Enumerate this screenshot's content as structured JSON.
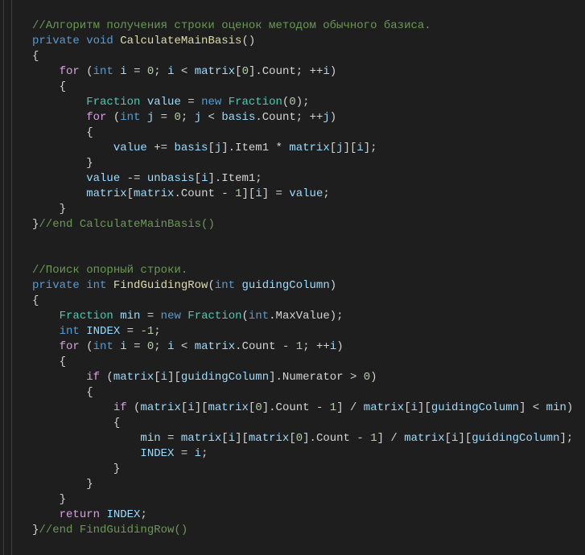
{
  "comments": {
    "algo": "//Алгоритм получения строки оценок методом обычного базиса.",
    "endBasis": "//end CalculateMainBasis()",
    "search": "//Поиск опорный строки.",
    "endGuiding": "//end FindGuidingRow()"
  },
  "kw": {
    "private": "private",
    "void": "void",
    "for": "for",
    "int": "int",
    "new": "new",
    "if": "if",
    "return": "return"
  },
  "types": {
    "Fraction": "Fraction"
  },
  "methods": {
    "CalculateMainBasis": "CalculateMainBasis",
    "FindGuidingRow": "FindGuidingRow"
  },
  "ids": {
    "i": "i",
    "j": "j",
    "value": "value",
    "matrix": "matrix",
    "basis": "basis",
    "unbasis": "unbasis",
    "min": "min",
    "INDEX": "INDEX",
    "guidingColumn": "guidingColumn"
  },
  "props": {
    "Count": "Count",
    "Item1": "Item1",
    "MaxValue": "MaxValue",
    "Numerator": "Numerator"
  },
  "nums": {
    "zero": "0",
    "one": "1",
    "negOne": "-1"
  }
}
